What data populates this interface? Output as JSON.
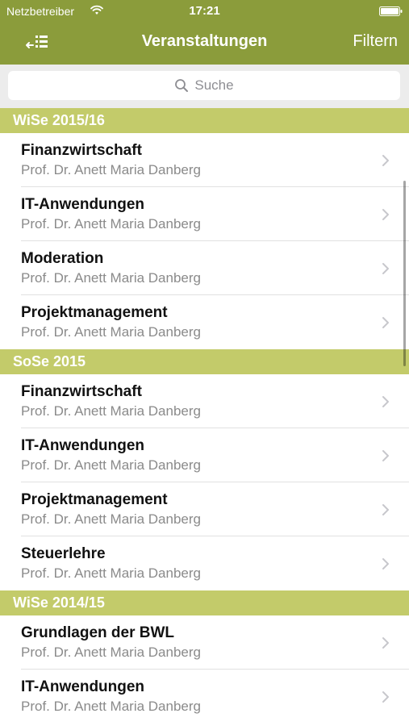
{
  "status": {
    "carrier": "Netzbetreiber",
    "time": "17:21"
  },
  "nav": {
    "title": "Veranstaltungen",
    "filter_label": "Filtern"
  },
  "search": {
    "placeholder": "Suche"
  },
  "sections": [
    {
      "title": "WiSe 2015/16",
      "items": [
        {
          "title": "Finanzwirtschaft",
          "subtitle": "Prof. Dr. Anett Maria Danberg"
        },
        {
          "title": "IT-Anwendungen",
          "subtitle": "Prof. Dr. Anett Maria Danberg"
        },
        {
          "title": "Moderation",
          "subtitle": "Prof. Dr. Anett Maria Danberg"
        },
        {
          "title": "Projektmanagement",
          "subtitle": "Prof. Dr. Anett Maria Danberg"
        }
      ]
    },
    {
      "title": "SoSe 2015",
      "items": [
        {
          "title": "Finanzwirtschaft",
          "subtitle": "Prof. Dr. Anett Maria Danberg"
        },
        {
          "title": "IT-Anwendungen",
          "subtitle": "Prof. Dr. Anett Maria Danberg"
        },
        {
          "title": "Projektmanagement",
          "subtitle": "Prof. Dr. Anett Maria Danberg"
        },
        {
          "title": "Steuerlehre",
          "subtitle": "Prof. Dr. Anett Maria Danberg"
        }
      ]
    },
    {
      "title": "WiSe 2014/15",
      "items": [
        {
          "title": "Grundlagen der BWL",
          "subtitle": "Prof. Dr. Anett Maria Danberg"
        },
        {
          "title": "IT-Anwendungen",
          "subtitle": "Prof. Dr. Anett Maria Danberg"
        }
      ]
    }
  ],
  "icons": {
    "menu": "list-menu-icon",
    "search": "search-icon",
    "row_disclosure": "chevron-right-icon",
    "wifi": "wifi-icon",
    "battery": "battery-icon"
  },
  "colors": {
    "nav_bar": "#8b9c3b",
    "section_header": "#c3cb6a",
    "search_background": "#ececec"
  }
}
